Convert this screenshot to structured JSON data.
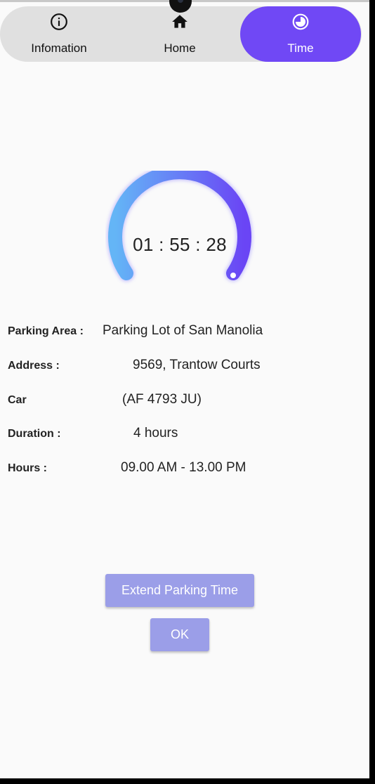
{
  "tabs": {
    "info": {
      "label": "Infomation",
      "icon": "info-icon"
    },
    "home": {
      "label": "Home",
      "icon": "home-icon"
    },
    "time": {
      "label": "Time",
      "icon": "timer-icon",
      "active": true
    }
  },
  "colors": {
    "accent": "#7048f5",
    "tabbar_bg": "#e0e0e0",
    "button_bg": "#9b9ee8",
    "gauge_start": "#64b5f6",
    "gauge_end": "#6a45f5"
  },
  "timer": {
    "display": "01 : 55 : 28"
  },
  "details": {
    "parking_area": {
      "label": "Parking Area :",
      "value": "Parking Lot of San Manolia"
    },
    "address": {
      "label": "Address :",
      "value": "9569, Trantow Courts"
    },
    "car": {
      "label": "Car",
      "value": "(AF 4793 JU)"
    },
    "duration": {
      "label": "Duration :",
      "value": "4 hours"
    },
    "hours": {
      "label": "Hours :",
      "value": "09.00 AM - 13.00 PM"
    }
  },
  "buttons": {
    "extend": "Extend Parking Time",
    "ok": "OK"
  }
}
